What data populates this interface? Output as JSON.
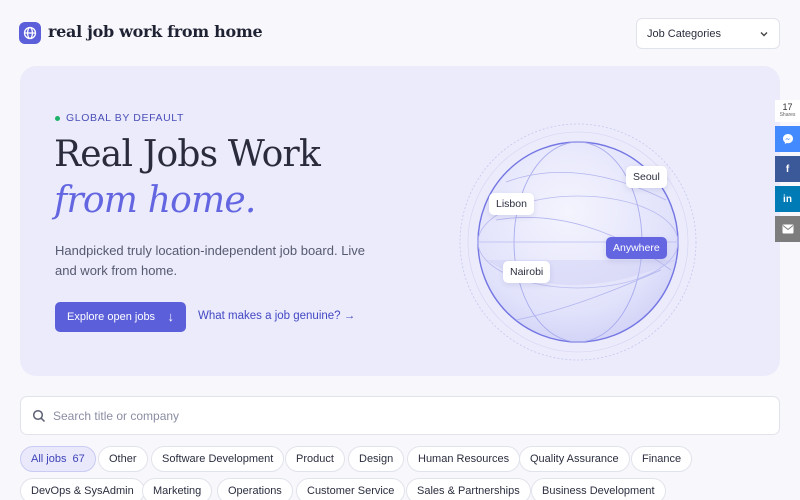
{
  "header": {
    "brand": "real job work from home",
    "categories_label": "Job Categories"
  },
  "hero": {
    "kicker": "GLOBAL BY DEFAULT",
    "title_line1": "Real Jobs Work",
    "title_line2": "from home.",
    "lead": "Handpicked truly location-independent job board. Live and work from home.",
    "cta_label": "Explore open jobs",
    "cta_arrow": "↓",
    "secondary_link": "What makes a job genuine? →",
    "globe_tags": [
      "Seoul",
      "Lisbon",
      "Anywhere",
      "Nairobi"
    ]
  },
  "share": {
    "count": "17",
    "count_label": "Shares",
    "buttons": [
      {
        "icon": "messenger-icon",
        "color": "#448aff"
      },
      {
        "icon": "facebook-icon",
        "color": "#3b5998",
        "glyph": "f"
      },
      {
        "icon": "linkedin-icon",
        "color": "#007bb5",
        "glyph": "in"
      },
      {
        "icon": "email-icon",
        "color": "#7d7d7d"
      }
    ]
  },
  "search": {
    "placeholder": "Search title or company"
  },
  "filters": {
    "all_label": "All jobs",
    "all_count": "67",
    "chips": [
      "Other",
      "Software Development",
      "Product",
      "Design",
      "Human Resources",
      "Quality Assurance",
      "Finance",
      "DevOps & SysAdmin",
      "Marketing",
      "Operations",
      "Customer Service",
      "Sales & Partnerships",
      "Business Development"
    ]
  },
  "colors": {
    "accent": "#5b5fd9",
    "hero_bg": "#ebebfb",
    "status_dot": "#1fb26a"
  }
}
